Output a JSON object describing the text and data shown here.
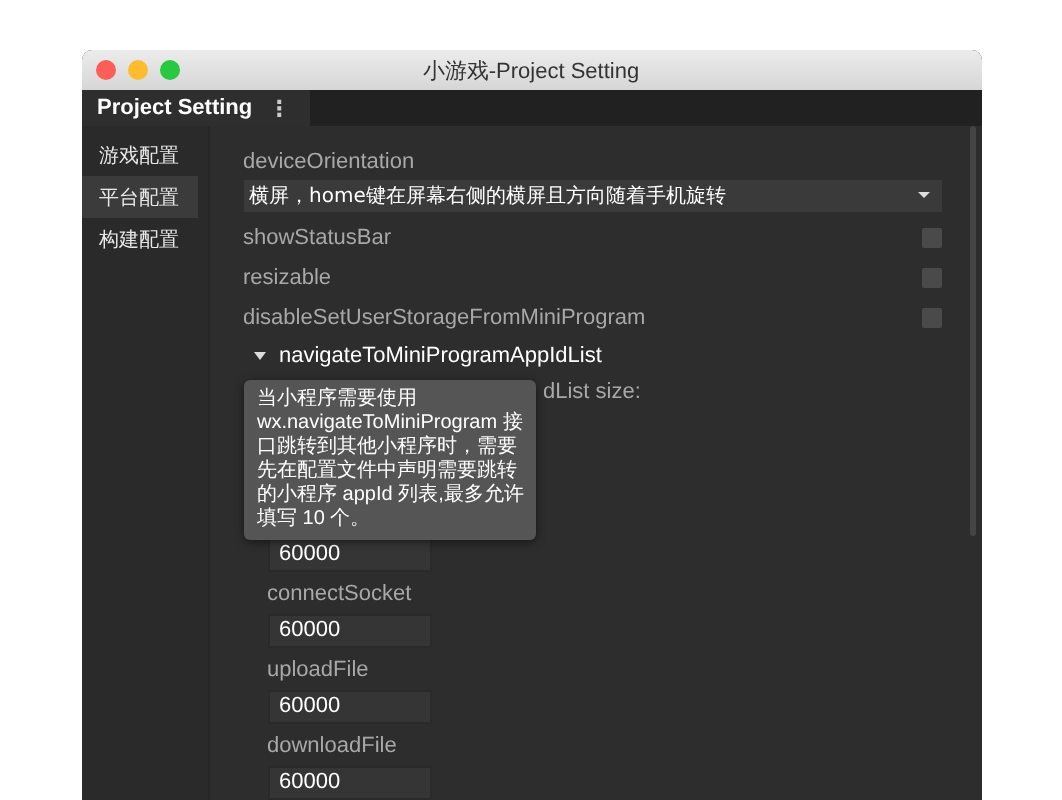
{
  "window": {
    "title": "小游戏-Project Setting"
  },
  "tab": {
    "label": "Project Setting",
    "menu": "⋮"
  },
  "sidebar": {
    "items": [
      {
        "label": "游戏配置",
        "selected": false
      },
      {
        "label": "平台配置",
        "selected": true
      },
      {
        "label": "构建配置",
        "selected": false
      }
    ]
  },
  "settings": [
    {
      "kind": "select",
      "label": "deviceOrientation",
      "value": "横屏，home键在屏幕右侧的横屏且方向随着手机旋转"
    },
    {
      "kind": "checkbox",
      "label": "showStatusBar",
      "checked": false
    },
    {
      "kind": "checkbox",
      "label": "resizable",
      "checked": false
    },
    {
      "kind": "checkbox",
      "label": "disableSetUserStorageFromMiniProgram",
      "checked": false
    },
    {
      "kind": "list",
      "label": "navigateToMiniProgramAppIdList",
      "expanded": true,
      "size_label": "dList size:"
    }
  ],
  "tooltip": "当小程序需要使用 wx.navigateToMiniProgram 接口跳转到其他小程序时，需要先在配置文件中声明需要跳转的小程序 appId 列表,最多允许填写 10 个。",
  "timeouts": [
    {
      "value": "60000"
    },
    {
      "label": "connectSocket",
      "value": "60000"
    },
    {
      "label": "uploadFile",
      "value": "60000"
    },
    {
      "label": "downloadFile",
      "value": "60000"
    }
  ]
}
